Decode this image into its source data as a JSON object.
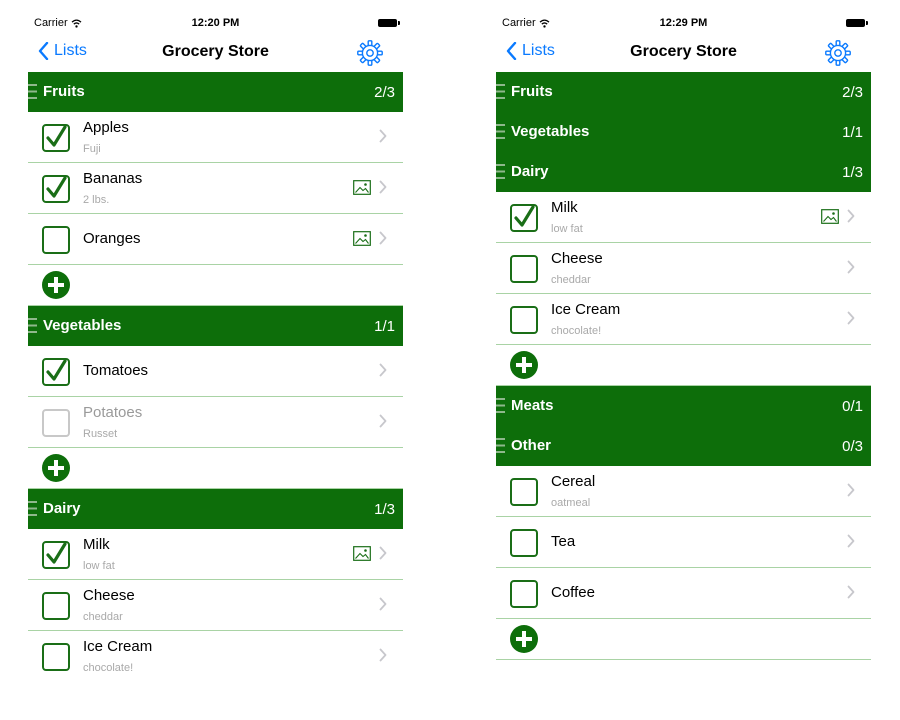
{
  "colors": {
    "header": "#0d6e0a",
    "checkbox": "#1a6e17",
    "separator": "#a9d3a5",
    "link": "#0a7aff"
  },
  "icons": [
    "wifi-icon",
    "battery-icon",
    "back-chevron-icon",
    "gear-icon",
    "grip-icon",
    "checkmark-icon",
    "image-icon",
    "chevron-right-icon",
    "plus-circle-icon"
  ],
  "screens": [
    {
      "status": {
        "carrier": "Carrier",
        "time": "12:20 PM"
      },
      "nav": {
        "back": "Lists",
        "title": "Grocery Store"
      },
      "sections": [
        {
          "name": "Fruits",
          "count": "2/3",
          "expanded": true,
          "items": [
            {
              "name": "Apples",
              "desc": "Fuji",
              "checked": true,
              "image": false,
              "dim": false
            },
            {
              "name": "Bananas",
              "desc": "2 lbs.",
              "checked": true,
              "image": true,
              "dim": false
            },
            {
              "name": "Oranges",
              "desc": "",
              "checked": false,
              "image": true,
              "dim": false
            }
          ]
        },
        {
          "name": "Vegetables",
          "count": "1/1",
          "expanded": true,
          "items": [
            {
              "name": "Tomatoes",
              "desc": "",
              "checked": true,
              "image": false,
              "dim": false
            },
            {
              "name": "Potatoes",
              "desc": "Russet",
              "checked": false,
              "image": false,
              "dim": true
            }
          ]
        },
        {
          "name": "Dairy",
          "count": "1/3",
          "expanded": true,
          "noAdd": true,
          "items": [
            {
              "name": "Milk",
              "desc": "low fat",
              "checked": true,
              "image": true,
              "dim": false
            },
            {
              "name": "Cheese",
              "desc": "cheddar",
              "checked": false,
              "image": false,
              "dim": false
            },
            {
              "name": "Ice Cream",
              "desc": "chocolate!",
              "checked": false,
              "image": false,
              "dim": false
            }
          ]
        }
      ]
    },
    {
      "status": {
        "carrier": "Carrier",
        "time": "12:29 PM"
      },
      "nav": {
        "back": "Lists",
        "title": "Grocery Store"
      },
      "sections": [
        {
          "name": "Fruits",
          "count": "2/3",
          "expanded": false,
          "items": []
        },
        {
          "name": "Vegetables",
          "count": "1/1",
          "expanded": false,
          "items": []
        },
        {
          "name": "Dairy",
          "count": "1/3",
          "expanded": true,
          "items": [
            {
              "name": "Milk",
              "desc": "low fat",
              "checked": true,
              "image": true,
              "dim": false
            },
            {
              "name": "Cheese",
              "desc": "cheddar",
              "checked": false,
              "image": false,
              "dim": false
            },
            {
              "name": "Ice Cream",
              "desc": "chocolate!",
              "checked": false,
              "image": false,
              "dim": false
            }
          ]
        },
        {
          "name": "Meats",
          "count": "0/1",
          "expanded": false,
          "items": []
        },
        {
          "name": "Other",
          "count": "0/3",
          "expanded": true,
          "items": [
            {
              "name": "Cereal",
              "desc": "oatmeal",
              "checked": false,
              "image": false,
              "dim": false
            },
            {
              "name": "Tea",
              "desc": "",
              "checked": false,
              "image": false,
              "dim": false
            },
            {
              "name": "Coffee",
              "desc": "",
              "checked": false,
              "image": false,
              "dim": false
            }
          ]
        }
      ]
    }
  ]
}
